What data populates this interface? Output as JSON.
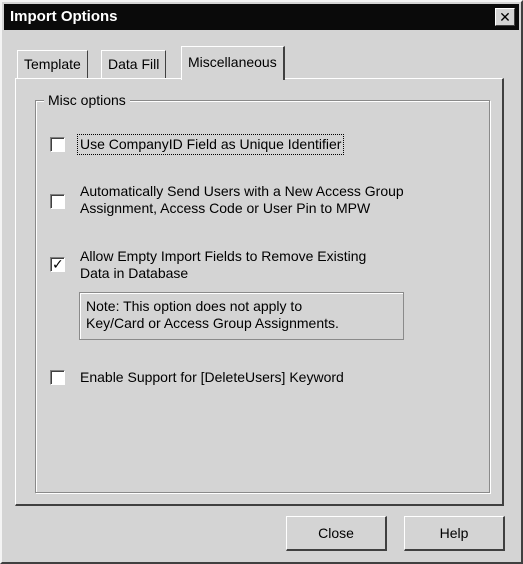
{
  "window": {
    "title": "Import Options",
    "close_glyph": "✕"
  },
  "tabs": [
    {
      "label": "Template",
      "active": false
    },
    {
      "label": "Data Fill",
      "active": false
    },
    {
      "label": "Miscellaneous",
      "active": true
    }
  ],
  "group": {
    "legend": "Misc options"
  },
  "options": [
    {
      "text": "Use CompanyID Field as Unique Identifier",
      "checked": false
    },
    {
      "line1": "Automatically Send Users with a New Access Group",
      "line2": "Assignment, Access Code or User Pin to MPW",
      "checked": false
    },
    {
      "line1": "Allow Empty Import Fields to Remove Existing",
      "line2": "Data in Database",
      "checked": true
    },
    {
      "text": "Enable Support for [DeleteUsers] Keyword",
      "checked": false
    }
  ],
  "note": {
    "line1": "Note: This option does not apply to",
    "line2": "Key/Card or Access Group Assignments."
  },
  "checkmark_glyph": "✓",
  "buttons": {
    "close": "Close",
    "help": "Help"
  },
  "colors": {
    "titlebar": "#0a0a0a",
    "face": "#d4d4d4"
  }
}
